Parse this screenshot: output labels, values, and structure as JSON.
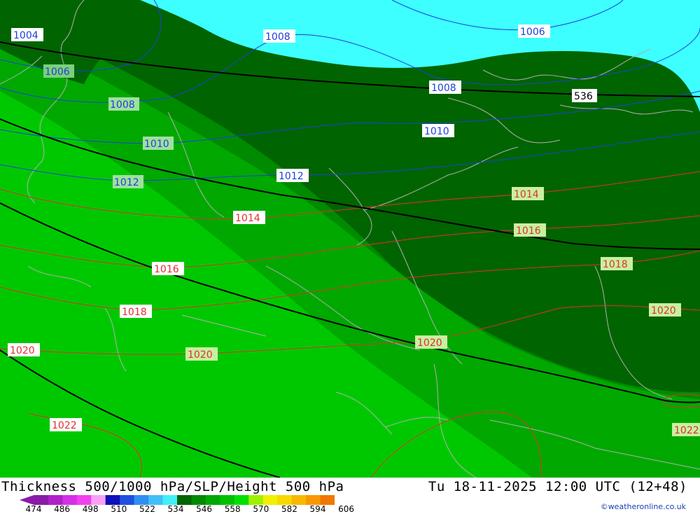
{
  "title": "Thickness 500/1000 hPa/SLP/Height 500 hPa",
  "valid_time": "Tu 18-11-2025 12:00 UTC (12+48)",
  "credit": "©weatheronline.co.uk",
  "colors": {
    "sea": "#3dffff",
    "band_528_534": "#006400",
    "band_534_540": "#008a00",
    "band_540_546": "#00a800",
    "band_546_552": "#00c800",
    "slp_low_isobar": "#2040d8",
    "slp_high_isobar": "#e03030",
    "height_line": "#000000",
    "coast_border": "#b0b0b0"
  },
  "scale": {
    "labels": [
      "474",
      "486",
      "498",
      "510",
      "522",
      "534",
      "546",
      "558",
      "570",
      "582",
      "594",
      "606"
    ],
    "colors": [
      "#8a1aa8",
      "#b020c8",
      "#d430e8",
      "#f040f0",
      "#f8a0f8",
      "#1010b8",
      "#2050e0",
      "#3090f0",
      "#40c0f8",
      "#40f0f8",
      "#006400",
      "#008a00",
      "#00a800",
      "#00c000",
      "#00e000",
      "#a0f000",
      "#f0f000",
      "#f8d800",
      "#f8b800",
      "#f89800",
      "#f07800"
    ]
  },
  "isobar_labels": [
    {
      "id": "l1004",
      "text": "1004",
      "color": "blue"
    },
    {
      "id": "l1006a",
      "text": "1006",
      "color": "blue"
    },
    {
      "id": "l1006b",
      "text": "1006",
      "color": "blue"
    },
    {
      "id": "l1008a",
      "text": "1008",
      "color": "blue"
    },
    {
      "id": "l1008b",
      "text": "1008",
      "color": "blue"
    },
    {
      "id": "l1008c",
      "text": "1008",
      "color": "blue"
    },
    {
      "id": "l1010a",
      "text": "1010",
      "color": "blue"
    },
    {
      "id": "l1010b",
      "text": "1010",
      "color": "blue"
    },
    {
      "id": "l1012a",
      "text": "1012",
      "color": "blue"
    },
    {
      "id": "l1012b",
      "text": "1012",
      "color": "blue"
    },
    {
      "id": "l1014a",
      "text": "1014",
      "color": "red"
    },
    {
      "id": "l1014b",
      "text": "1014",
      "color": "red"
    },
    {
      "id": "l1016a",
      "text": "1016",
      "color": "red"
    },
    {
      "id": "l1016b",
      "text": "1016",
      "color": "red"
    },
    {
      "id": "l1018a",
      "text": "1018",
      "color": "red"
    },
    {
      "id": "l1018b",
      "text": "1018",
      "color": "red"
    },
    {
      "id": "l1020a",
      "text": "1020",
      "color": "red"
    },
    {
      "id": "l1020b",
      "text": "1020",
      "color": "red"
    },
    {
      "id": "l1020c",
      "text": "1020",
      "color": "red"
    },
    {
      "id": "l1020d",
      "text": "1020",
      "color": "red"
    },
    {
      "id": "l1022a",
      "text": "1022",
      "color": "red"
    },
    {
      "id": "l1022b",
      "text": "1022",
      "color": "red"
    }
  ],
  "height_labels": [
    {
      "id": "h536",
      "text": "536"
    }
  ]
}
